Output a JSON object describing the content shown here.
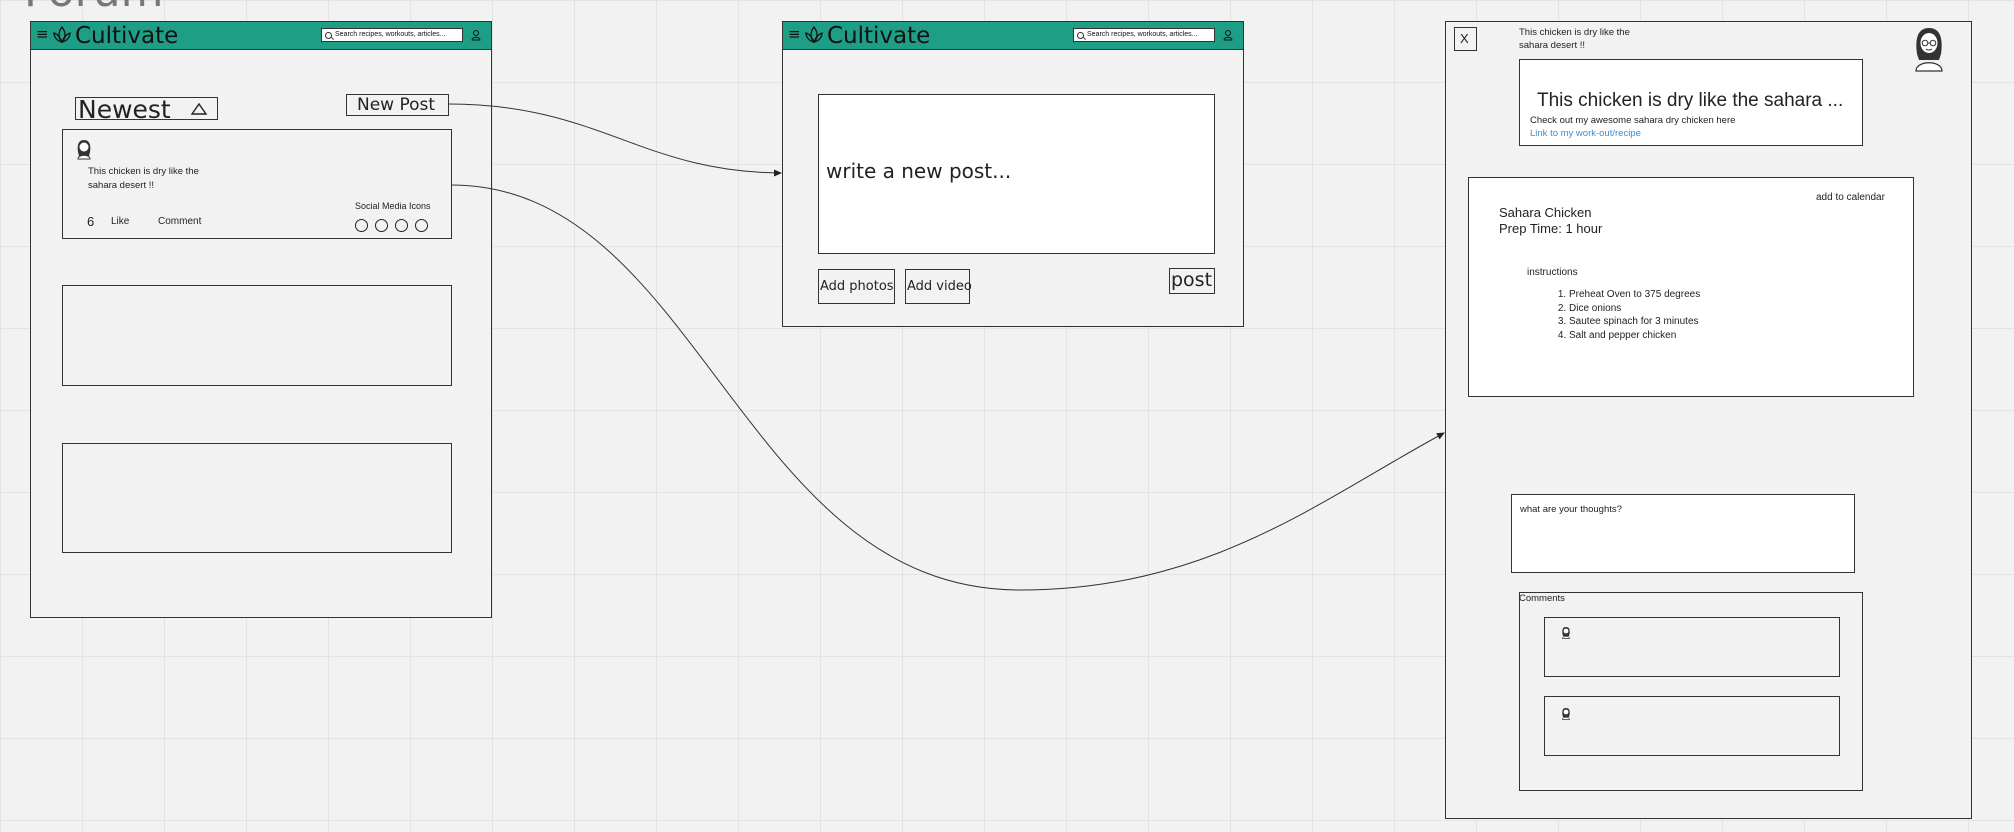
{
  "canvas_title": "Forum",
  "app": {
    "brand": "Cultivate"
  },
  "feed_screen": {
    "search_placeholder": "Search recipes, workouts, articles...",
    "sort_label": "Newest",
    "new_post_label": "New Post",
    "post": {
      "text_line1": "This chicken is dry like the",
      "text_line2": "sahara desert !!",
      "like_count": "6",
      "like_label": "Like",
      "comment_label": "Comment",
      "social_label": "Social Media Icons"
    }
  },
  "compose_screen": {
    "search_placeholder": "Search recipes, workouts, articles...",
    "placeholder": "write a new post...",
    "add_photos_label": "Add photos",
    "add_video_label": "Add video",
    "post_label": "post"
  },
  "detail_screen": {
    "close_label": "X",
    "header_line1": "This chicken is dry like the",
    "header_line2": "sahara desert !!",
    "post_title": "This chicken is dry like the sahara ...",
    "post_subtitle": "Check out my awesome sahara dry chicken here",
    "post_link": "Link to my work-out/recipe",
    "add_calendar_label": "add to calendar",
    "recipe_name": "Sahara Chicken",
    "prep_time": "Prep Time: 1 hour",
    "instructions_label": "instructions",
    "instructions": [
      "Preheat Oven to 375 degrees",
      "Dice onions",
      "Sautee spinach for 3 minutes",
      "Salt and pepper chicken"
    ],
    "thoughts_placeholder": "what are your thoughts?",
    "comments_label": "Comments"
  },
  "colors": {
    "accent": "#1f9e86",
    "link": "#3a8fd6"
  }
}
